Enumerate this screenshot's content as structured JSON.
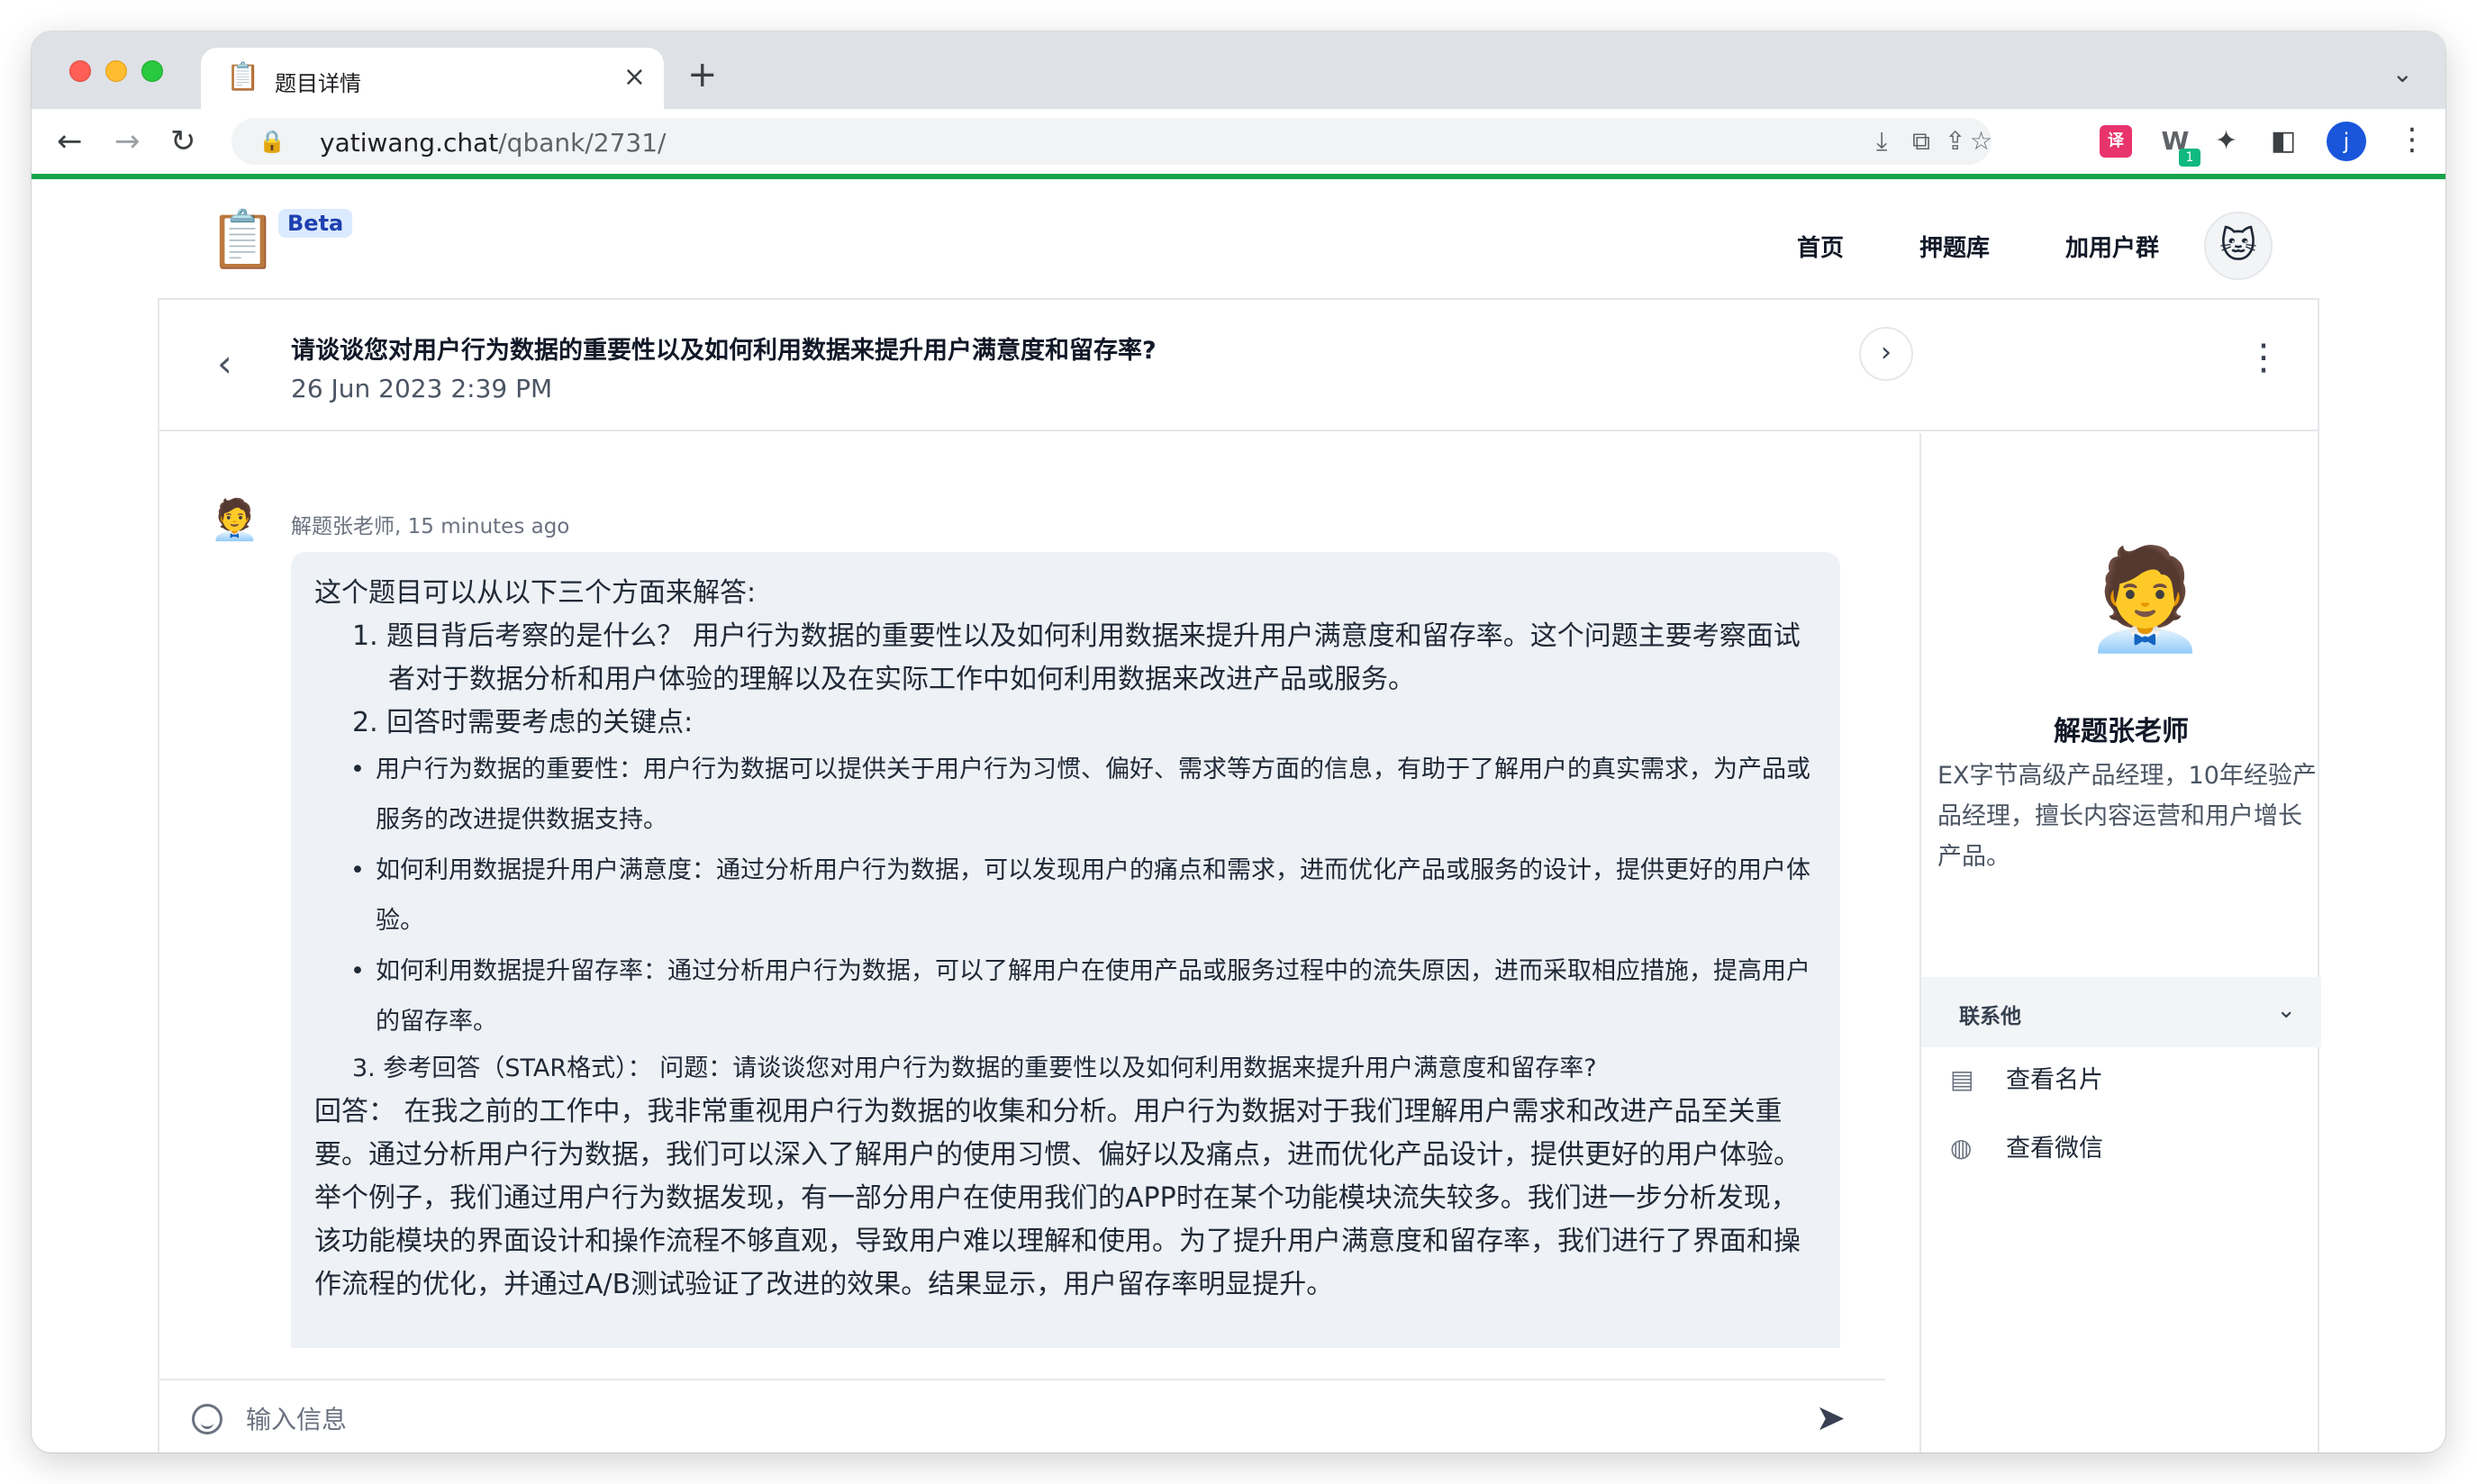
{
  "browser": {
    "tab_title": "题目详情",
    "tab_favicon": "📋",
    "url_host": "yatiwang.chat",
    "url_path": "/qbank/2731/",
    "profile_initial": "j",
    "extension_badge": "1"
  },
  "site": {
    "logo": "📋",
    "beta_label": "Beta",
    "nav": {
      "home": "首页",
      "bank": "押题库",
      "group": "加用户群"
    }
  },
  "question": {
    "title": "请谈谈您对用户行为数据的重要性以及如何利用数据来提升用户满意度和留存率?",
    "date": "26 Jun 2023 2:39 PM"
  },
  "message": {
    "author_meta": "解题张老师, 15 minutes ago",
    "intro": "这个题目可以从以下三个方面来解答:",
    "item1": "1. 题目背后考察的是什么？ 用户行为数据的重要性以及如何利用数据来提升用户满意度和留存率。这个问题主要考察面试者对于数据分析和用户体验的理解以及在实际工作中如何利用数据来改进产品或服务。",
    "item2": "2. 回答时需要考虑的关键点:",
    "bullet1": "用户行为数据的重要性：用户行为数据可以提供关于用户行为习惯、偏好、需求等方面的信息，有助于了解用户的真实需求，为产品或服务的改进提供数据支持。",
    "bullet2": "如何利用数据提升用户满意度：通过分析用户行为数据，可以发现用户的痛点和需求，进而优化产品或服务的设计，提供更好的用户体验。",
    "bullet3": "如何利用数据提升留存率：通过分析用户行为数据，可以了解用户在使用产品或服务过程中的流失原因，进而采取相应措施，提高用户的留存率。",
    "item3": "3. 参考回答（STAR格式）： 问题：请谈谈您对用户行为数据的重要性以及如何利用数据来提升用户满意度和留存率?",
    "answer1": "回答： 在我之前的工作中，我非常重视用户行为数据的收集和分析。用户行为数据对于我们理解用户需求和改进产品至关重要。通过分析用户行为数据，我们可以深入了解用户的使用习惯、偏好以及痛点，进而优化产品设计，提供更好的用户体验。",
    "answer2": "举个例子，我们通过用户行为数据发现，有一部分用户在使用我们的APP时在某个功能模块流失较多。我们进一步分析发现，该功能模块的界面设计和操作流程不够直观，导致用户难以理解和使用。为了提升用户满意度和留存率，我们进行了界面和操作流程的优化，并通过A/B测试验证了改进的效果。结果显示，用户留存率明显提升。"
  },
  "input": {
    "placeholder": "输入信息"
  },
  "mentor": {
    "name": "解题张老师",
    "bio": "EX字节高级产品经理，10年经验产品经理，擅长内容运营和用户增长产品。",
    "contact_label": "联系他",
    "contact_card": "查看名片",
    "contact_wechat": "查看微信"
  },
  "colors": {
    "progress": "#16a34a",
    "bubble_bg": "#eef1f5",
    "beta_bg": "#dbeafe"
  }
}
